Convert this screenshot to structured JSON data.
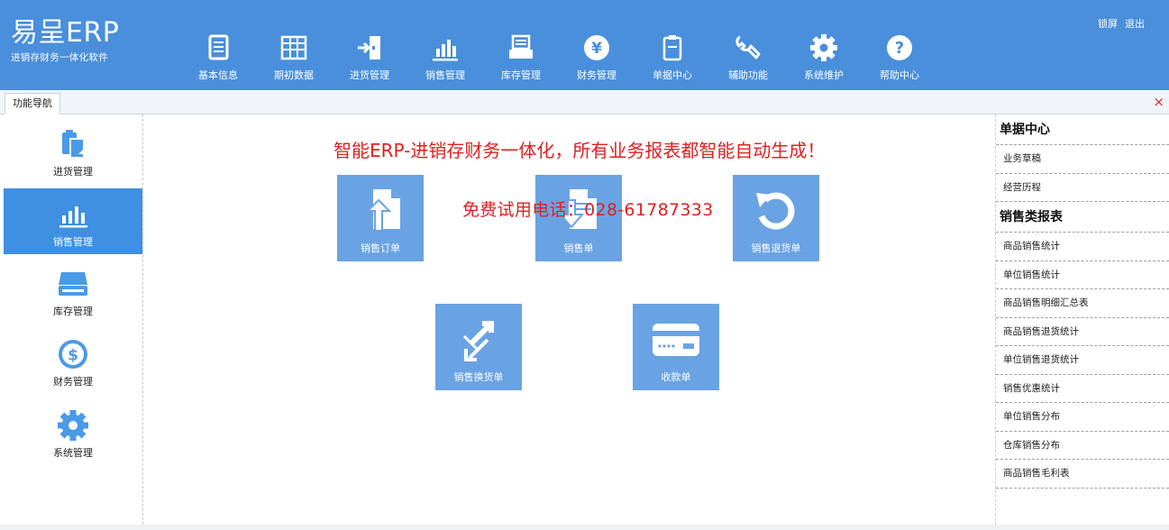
{
  "colors": {
    "header_bg": "#4a8fdb",
    "sidebar_active": "#3f8fe2",
    "tile_bg": "#6aa3e3",
    "red_text": "#e02020",
    "close_x": "#e0262a"
  },
  "logo": {
    "title": "易呈ERP",
    "subtitle": "进销存财务一体化软件"
  },
  "header_links": {
    "lock": "锁屏",
    "logout": "退出"
  },
  "topnav": [
    {
      "label": "基本信息",
      "icon": "document-list-icon"
    },
    {
      "label": "期初数据",
      "icon": "table-grid-icon"
    },
    {
      "label": "进货管理",
      "icon": "enter-door-icon"
    },
    {
      "label": "销售管理",
      "icon": "bar-chart-icon"
    },
    {
      "label": "库存管理",
      "icon": "inventory-tray-icon"
    },
    {
      "label": "财务管理",
      "icon": "yen-circle-icon"
    },
    {
      "label": "单据中心",
      "icon": "clipboard-icon"
    },
    {
      "label": "辅助功能",
      "icon": "wrench-icon"
    },
    {
      "label": "系统维护",
      "icon": "gear-icon"
    },
    {
      "label": "帮助中心",
      "icon": "help-circle-icon"
    }
  ],
  "tab": {
    "label": "功能导航",
    "close": "×"
  },
  "sidebar": [
    {
      "label": "进货管理",
      "icon": "clipboard-icon",
      "active": false
    },
    {
      "label": "销售管理",
      "icon": "bar-chart-icon",
      "active": true
    },
    {
      "label": "库存管理",
      "icon": "inventory-drive-icon",
      "active": false
    },
    {
      "label": "财务管理",
      "icon": "dollar-circle-icon",
      "active": false
    },
    {
      "label": "系统管理",
      "icon": "gear-icon",
      "active": false
    }
  ],
  "main": {
    "title": "智能ERP-进销存财务一体化，所有业务报表都智能自动生成！",
    "phone": "免费试用电话：028-61787333",
    "tiles": [
      {
        "label": "销售订单",
        "icon": "upload-document-icon"
      },
      {
        "label": "销售单",
        "icon": "download-document-icon"
      },
      {
        "label": "销售退货单",
        "icon": "undo-arrow-icon"
      },
      {
        "label": "销售换货单",
        "icon": "exchange-arrows-icon"
      },
      {
        "label": "收款单",
        "icon": "payment-card-icon"
      }
    ]
  },
  "right_panel": {
    "section1": {
      "title": "单据中心",
      "items": [
        "业务草稿",
        "经营历程"
      ]
    },
    "section2": {
      "title": "销售类报表",
      "items": [
        "商品销售统计",
        "单位销售统计",
        "商品销售明细汇总表",
        "商品销售退货统计",
        "单位销售退货统计",
        "销售优惠统计",
        "单位销售分布",
        "仓库销售分布",
        "商品销售毛利表"
      ]
    }
  }
}
